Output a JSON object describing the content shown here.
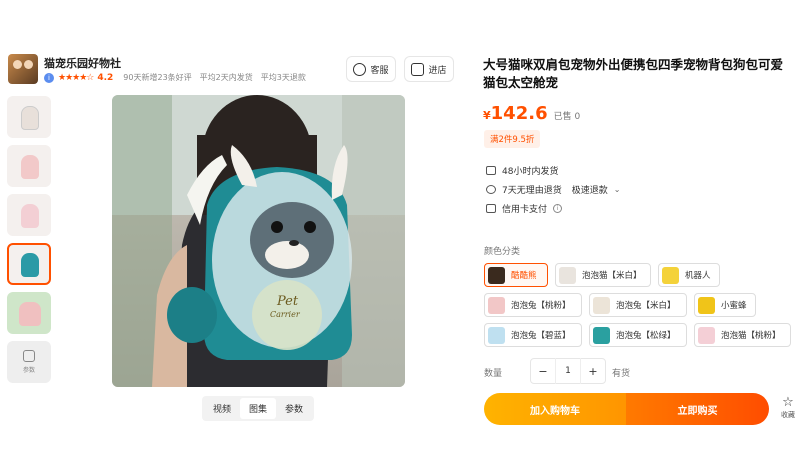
{
  "shop": {
    "name": "猫宠乐园好物社",
    "rating": "4.2",
    "stats": [
      "90天新增23条好评",
      "平均2天内发货",
      "平均3天退款"
    ],
    "service_label": "客服",
    "enter_label": "进店"
  },
  "gallery": {
    "thumb_names": [
      "thumb-1",
      "thumb-2",
      "thumb-3",
      "thumb-4",
      "thumb-5"
    ],
    "more_label": "参数",
    "main_text": [
      "Pet",
      "Carrier"
    ],
    "media_tabs": [
      "视频",
      "图集",
      "参数"
    ],
    "active_tab": "图集"
  },
  "product": {
    "title": "大号猫咪双肩包宠物外出便携包四季宠物背包狗包可爱猫包太空舱宠",
    "currency": "¥",
    "price": "142.6",
    "sold": "已售 0",
    "promo": "满2件9.5折",
    "services": [
      {
        "icon": "box-icon",
        "text": "48小时内发货"
      },
      {
        "icon": "return-icon",
        "text": "7天无理由退货",
        "extra": "极速退款"
      },
      {
        "icon": "card-icon",
        "text": "信用卡支付"
      }
    ],
    "variant_label": "颜色分类",
    "variants": [
      {
        "label": "酷酷熊",
        "color": "#3a2a1e",
        "active": true
      },
      {
        "label": "泡泡猫【米白】",
        "color": "#e9e4de"
      },
      {
        "label": "机器人",
        "color": "#f4d23a"
      },
      {
        "label": "泡泡兔【桃粉】",
        "color": "#f2c7c7"
      },
      {
        "label": "泡泡兔【米白】",
        "color": "#ece4d8"
      },
      {
        "label": "小蜜蜂",
        "color": "#f0c419"
      },
      {
        "label": "泡泡兔【碧蓝】",
        "color": "#bfe0f0"
      },
      {
        "label": "泡泡兔【松绿】",
        "color": "#2aa0a0"
      },
      {
        "label": "泡泡猫【桃粉】",
        "color": "#f4cfd6"
      }
    ],
    "qty_label": "数量",
    "qty_value": "1",
    "qty_minus": "−",
    "qty_plus": "+",
    "stock": "有货",
    "cart_label": "加入购物车",
    "buy_label": "立即购买",
    "fav_label": "收藏"
  }
}
